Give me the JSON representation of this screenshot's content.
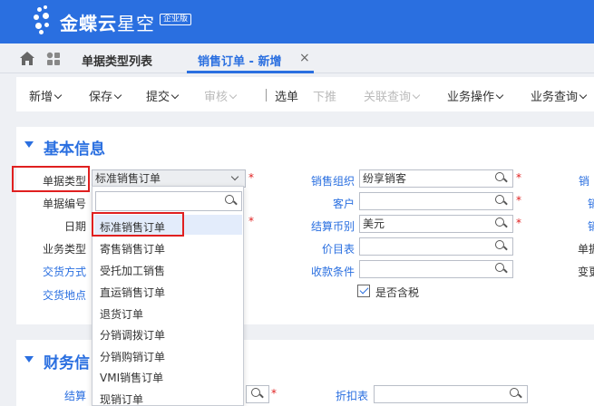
{
  "header": {
    "brand": "金蝶云",
    "brand_sub": "星空",
    "edition": "企业版"
  },
  "tabs": {
    "list": "单据类型列表",
    "active": "销售订单 - 新增",
    "close": "×"
  },
  "toolbar": {
    "items": [
      "新增",
      "保存",
      "提交",
      "审核",
      "选单",
      "下推",
      "关联查询",
      "业务操作",
      "业务查询"
    ]
  },
  "basic": {
    "title": "基本信息",
    "bill_type_label": "单据类型",
    "bill_type_value": "标准销售订单",
    "bill_no_label": "单据编号",
    "date_label": "日期",
    "biz_type_label": "业务类型",
    "delivery_method_label": "交货方式",
    "delivery_place_label": "交货地点",
    "sales_org_label": "销售组织",
    "sales_org_value": "纷享销客",
    "customer_label": "客户",
    "currency_label": "结算币别",
    "currency_value": "美元",
    "price_list_label": "价目表",
    "payment_terms_label": "收款条件",
    "tax_included_label": "是否含税",
    "right_col_1": "销",
    "right_col_2": "销",
    "right_col_3": "销",
    "right_col_4": "单据",
    "right_col_5": "变更"
  },
  "dropdown": {
    "items": [
      "标准销售订单",
      "寄售销售订单",
      "受托加工销售",
      "直运销售订单",
      "退货订单",
      "分销调拨订单",
      "分销购销订单",
      "VMI销售订单",
      "现销订单"
    ]
  },
  "finance": {
    "title": "财务信",
    "settle_label": "结算",
    "discount_label": "折扣表"
  },
  "colors": {
    "brand_blue": "#2a6fe0",
    "highlight_red": "#e02020"
  }
}
